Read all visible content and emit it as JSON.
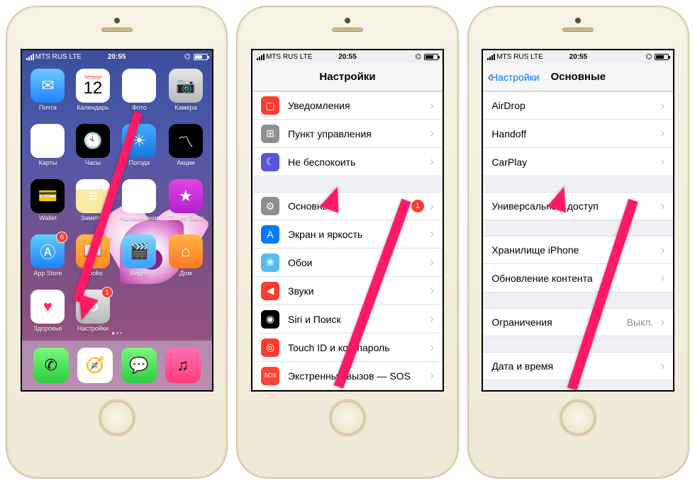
{
  "status": {
    "carrier": "MTS RUS",
    "network": "LTE",
    "time": "20:55"
  },
  "calendar_icon": {
    "day_of_week": "Четверг",
    "day": "12"
  },
  "homescreen_apps": [
    [
      {
        "label": "Почта",
        "cls": "ic-mail",
        "glyph": "✉︎"
      },
      {
        "label": "Календарь",
        "cls": "ic-cal"
      },
      {
        "label": "Фото",
        "cls": "ic-photos",
        "glyph": "❁"
      },
      {
        "label": "Камера",
        "cls": "ic-camera",
        "glyph": "📷"
      }
    ],
    [
      {
        "label": "Карты",
        "cls": "ic-maps",
        "glyph": "⌖"
      },
      {
        "label": "Часы",
        "cls": "ic-clock",
        "glyph": "🕙"
      },
      {
        "label": "Погода",
        "cls": "ic-weather",
        "glyph": "☀"
      },
      {
        "label": "Акции",
        "cls": "ic-stocks",
        "glyph": "〽"
      }
    ],
    [
      {
        "label": "Wallet",
        "cls": "ic-wallet",
        "glyph": "💳"
      },
      {
        "label": "Заметки",
        "cls": "ic-notes",
        "glyph": "≡"
      },
      {
        "label": "Напоминания",
        "cls": "ic-reminders",
        "glyph": "☑"
      },
      {
        "label": "iTunes Store",
        "cls": "ic-itunes",
        "glyph": "★"
      }
    ],
    [
      {
        "label": "App Store",
        "cls": "ic-appstore",
        "glyph": "Ⓐ",
        "badge": "6"
      },
      {
        "label": "iBooks",
        "cls": "ic-ibooks",
        "glyph": "📖"
      },
      {
        "label": "Видео",
        "cls": "ic-video",
        "glyph": "🎬"
      },
      {
        "label": "Дом",
        "cls": "ic-home",
        "glyph": "⌂"
      }
    ],
    [
      {
        "label": "Здоровье",
        "cls": "ic-health",
        "glyph": "♥"
      },
      {
        "label": "Настройки",
        "cls": "ic-settings",
        "glyph": "⚙",
        "badge": "1"
      }
    ]
  ],
  "dock_apps": [
    {
      "cls": "ic-phone",
      "glyph": "✆"
    },
    {
      "cls": "ic-safari",
      "glyph": "🧭"
    },
    {
      "cls": "ic-messages",
      "glyph": "💬"
    },
    {
      "cls": "ic-music",
      "glyph": "♫"
    }
  ],
  "screen2": {
    "title": "Настройки",
    "groups": [
      [
        {
          "icon": "ri-notif",
          "glyph": "▢",
          "label": "Уведомления"
        },
        {
          "icon": "ri-control",
          "glyph": "⊞",
          "label": "Пункт управления"
        },
        {
          "icon": "ri-dnd",
          "glyph": "☾",
          "label": "Не беспокоить"
        }
      ],
      [
        {
          "icon": "ri-general",
          "glyph": "⚙",
          "label": "Основные",
          "badge": "1"
        },
        {
          "icon": "ri-display",
          "glyph": "A",
          "label": "Экран и яркость"
        },
        {
          "icon": "ri-wallpaper",
          "glyph": "❀",
          "label": "Обои"
        },
        {
          "icon": "ri-sounds",
          "glyph": "◀",
          "label": "Звуки"
        },
        {
          "icon": "ri-siri",
          "glyph": "◉",
          "label": "Siri и Поиск"
        },
        {
          "icon": "ri-touchid",
          "glyph": "◎",
          "label": "Touch ID и код-пароль"
        },
        {
          "icon": "ri-sos",
          "glyph": "SOS",
          "label": "Экстренный вызов — SOS"
        }
      ]
    ]
  },
  "screen3": {
    "back": "Настройки",
    "title": "Основные",
    "groups": [
      [
        {
          "label": "AirDrop"
        },
        {
          "label": "Handoff"
        },
        {
          "label": "CarPlay"
        }
      ],
      [
        {
          "label": "Универсальный доступ"
        }
      ],
      [
        {
          "label": "Хранилище iPhone"
        },
        {
          "label": "Обновление контента"
        }
      ],
      [
        {
          "label": "Ограничения",
          "detail": "Выкл."
        }
      ],
      [
        {
          "label": "Дата и время"
        }
      ]
    ]
  }
}
